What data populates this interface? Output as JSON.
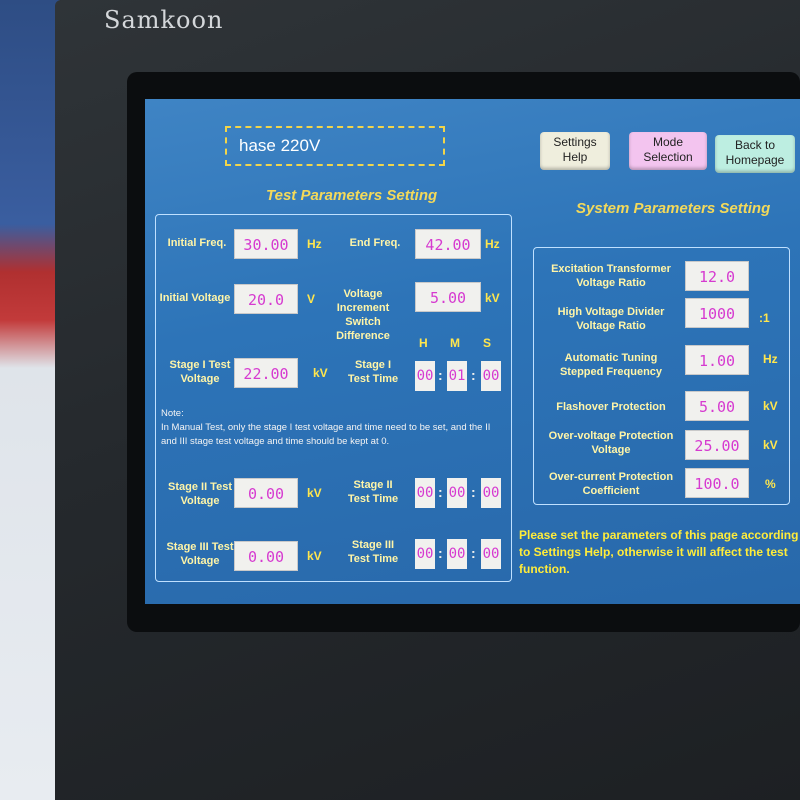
{
  "brand": "Samkoon",
  "status": "hase 220V",
  "buttons": {
    "settings_help": "Settings Help",
    "mode_selection": "Mode Selection",
    "back_home": "Back to Homepage"
  },
  "colors": {
    "settings_help_bg": "#efeedd",
    "mode_selection_bg": "#f3c4ef",
    "back_home_bg": "#bdeee1"
  },
  "test": {
    "title": "Test Parameters Setting",
    "initial_freq": {
      "label": "Initial Freq.",
      "value": "30.00",
      "unit": "Hz"
    },
    "end_freq": {
      "label": "End Freq.",
      "value": "42.00",
      "unit": "Hz"
    },
    "initial_voltage": {
      "label": "Initial Voltage",
      "value": "20.0",
      "unit": "V"
    },
    "voltage_increment": {
      "label": "Voltage Increment Switch Difference",
      "value": "5.00",
      "unit": "kV"
    },
    "time_headers": {
      "h": "H",
      "m": "M",
      "s": "S"
    },
    "stage1_voltage": {
      "label": "Stage I Test Voltage",
      "value": "22.00",
      "unit": "kV"
    },
    "stage1_time": {
      "label": "Stage I Test Time",
      "h": "00",
      "m": "01",
      "s": "00"
    },
    "note_title": "Note:",
    "note_text": "In Manual Test, only the stage I test voltage and time need to be set, and the II and III stage test voltage and time should be kept at 0.",
    "stage2_voltage": {
      "label": "Stage II Test Voltage",
      "value": "0.00",
      "unit": "kV"
    },
    "stage2_time": {
      "label": "Stage II Test Time",
      "h": "00",
      "m": "00",
      "s": "00"
    },
    "stage3_voltage": {
      "label": "Stage III Test Voltage",
      "value": "0.00",
      "unit": "kV"
    },
    "stage3_time": {
      "label": "Stage III Test Time",
      "h": "00",
      "m": "00",
      "s": "00"
    }
  },
  "system": {
    "title": "System Parameters Setting",
    "excitation": {
      "label": "Excitation Transformer Voltage Ratio",
      "value": "12.0",
      "unit": ""
    },
    "hv_divider": {
      "label": "High Voltage Divider Voltage Ratio",
      "value": "1000",
      "unit": ":1"
    },
    "auto_tuning": {
      "label": "Automatic Tuning Stepped Frequency",
      "value": "1.00",
      "unit": "Hz"
    },
    "flashover": {
      "label": "Flashover Protection",
      "value": "5.00",
      "unit": "kV"
    },
    "overvoltage": {
      "label": "Over-voltage Protection Voltage",
      "value": "25.00",
      "unit": "kV"
    },
    "overcurrent": {
      "label": "Over-current Protection Coefficient",
      "value": "100.0",
      "unit": "%"
    }
  },
  "warning": "Please set the parameters of this page according to Settings Help, otherwise it will affect the test function."
}
